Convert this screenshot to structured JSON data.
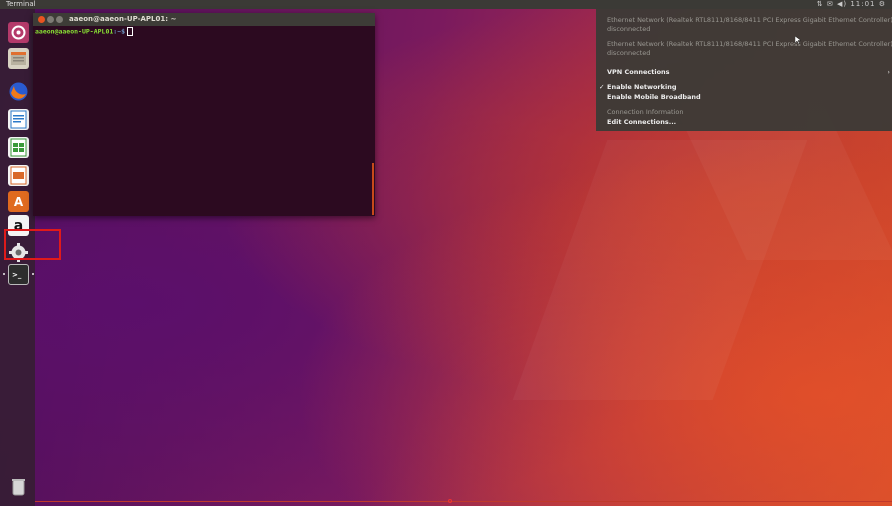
{
  "topbar": {
    "title": "Terminal",
    "indicators": "⇅ ✉ ◀) 11:01 ⚙"
  },
  "launcher": {
    "items": [
      {
        "name": "ubuntu-dash",
        "color": "#c24a6a",
        "icon": "dash-icon"
      },
      {
        "name": "files",
        "color": "#d8d2c2",
        "icon": "files-icon"
      },
      {
        "name": "firefox",
        "color": "#e66000",
        "icon": "firefox-icon"
      },
      {
        "name": "writer",
        "color": "#2b7ac9",
        "icon": "writer-icon"
      },
      {
        "name": "calc",
        "color": "#3a9a3a",
        "icon": "calc-icon"
      },
      {
        "name": "impress",
        "color": "#d9692a",
        "icon": "impress-icon"
      },
      {
        "name": "software-center",
        "color": "#e06a1f",
        "icon": "software-center-icon",
        "glyph": "A"
      },
      {
        "name": "amazon",
        "color": "#f4f4f4",
        "icon": "amazon-icon",
        "glyph": "a"
      },
      {
        "name": "system-settings",
        "color": "#8a8a8a",
        "icon": "settings-icon"
      },
      {
        "name": "terminal",
        "color": "#2d2d2d",
        "icon": "terminal-icon",
        "glyph": ">_"
      },
      {
        "name": "trash",
        "color": "#cfcfcf",
        "icon": "trash-icon"
      }
    ]
  },
  "terminal": {
    "title": "aaeon@aaeon-UP-APL01: ~",
    "prompt_user": "aaeon@aaeon-UP-APL01",
    "prompt_path": ":~$",
    "background": "#2c0a20"
  },
  "network_menu": {
    "items": [
      {
        "label": "Ethernet Network (Realtek RTL8111/8168/8411 PCI Express Gigabit Ethernet Controller)",
        "style": "dim"
      },
      {
        "label": "disconnected",
        "style": "dim"
      },
      {
        "label": "Ethernet Network (Realtek RTL8111/8168/8411 PCI Express Gigabit Ethernet Controller)",
        "style": "dim"
      },
      {
        "label": "disconnected",
        "style": "dim"
      },
      {
        "label": "VPN Connections",
        "style": "normal",
        "submenu": true
      },
      {
        "label": "Enable Networking",
        "style": "normal",
        "checked": true
      },
      {
        "label": "Enable Mobile Broadband",
        "style": "normal"
      },
      {
        "label": "Connection Information",
        "style": "dim"
      },
      {
        "label": "Edit Connections...",
        "style": "normal"
      }
    ]
  },
  "colors": {
    "highlight": "#e01a1a",
    "menu_bg": "#3c3a36"
  }
}
